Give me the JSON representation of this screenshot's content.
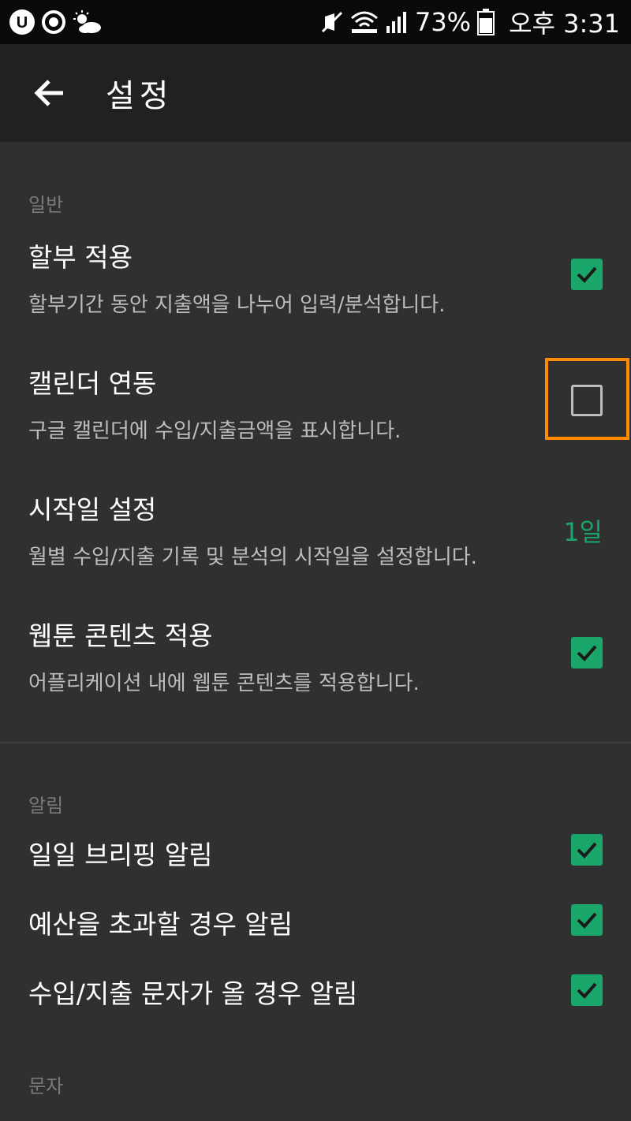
{
  "status_bar": {
    "battery": "73%",
    "time": "오후 3:31"
  },
  "app_bar": {
    "title": "설정",
    "back_icon": "arrow-back-icon"
  },
  "colors": {
    "accent": "#1aa56b",
    "highlight": "#ff8a00",
    "background": "#303030",
    "app_bar": "#212121"
  },
  "sections": {
    "general": {
      "header": "일반",
      "items": [
        {
          "title": "할부 적용",
          "summary": "할부기간 동안 지출액을 나누어 입력/분석합니다.",
          "checked": true
        },
        {
          "title": "캘린더 연동",
          "summary": "구글 캘린더에 수입/지출금액을 표시합니다.",
          "checked": false
        },
        {
          "title": "시작일 설정",
          "summary": "월별 수입/지출 기록 및 분석의 시작일을 설정합니다.",
          "value": "1일"
        },
        {
          "title": "웹툰 콘텐츠 적용",
          "summary": "어플리케이션 내에 웹툰 콘텐츠를 적용합니다.",
          "checked": true
        }
      ]
    },
    "notifications": {
      "header": "알림",
      "items": [
        {
          "title": "일일 브리핑 알림",
          "checked": true
        },
        {
          "title": "예산을 초과할 경우 알림",
          "checked": true
        },
        {
          "title": "수입/지출 문자가 올 경우 알림",
          "checked": true
        }
      ]
    },
    "sms": {
      "header": "문자"
    }
  }
}
